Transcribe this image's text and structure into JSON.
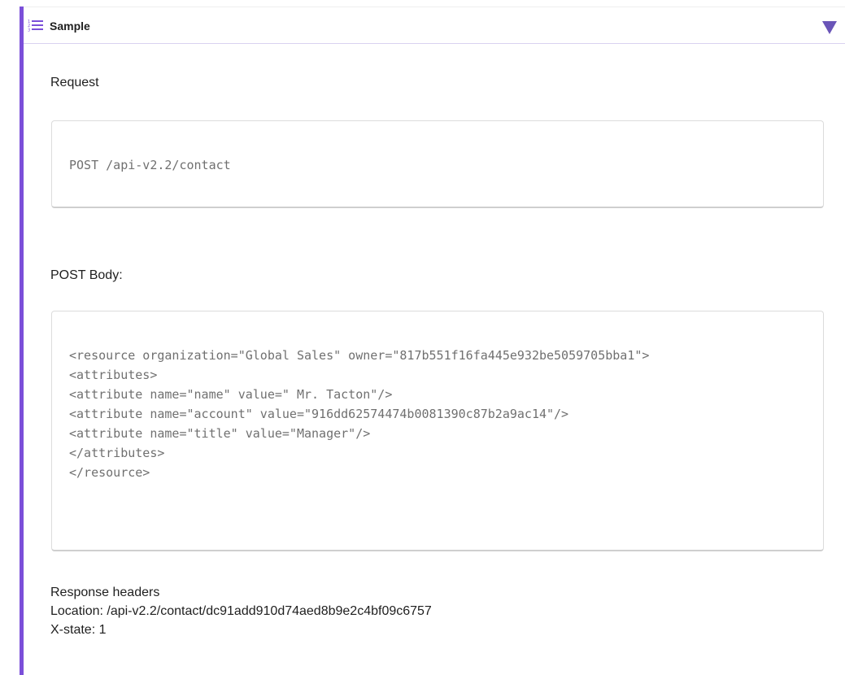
{
  "header": {
    "title": "Sample",
    "list_icon": "numbered-list-icon",
    "toggle_icon": "triangle-down-icon",
    "accent": "#7b4fd9"
  },
  "request": {
    "label": "Request",
    "code": "POST /api-v2.2/contact"
  },
  "post_body": {
    "label": "POST Body:",
    "lines": [
      "<resource organization=\"Global Sales\" owner=\"817b551f16fa445e932be5059705bba1\">",
      "<attributes>",
      "<attribute name=\"name\" value=\" Mr. Tacton\"/>",
      "<attribute name=\"account\" value=\"916dd62574474b0081390c87b2a9ac14\"/>",
      "<attribute name=\"title\" value=\"Manager\"/>",
      "</attributes>",
      "</resource>"
    ]
  },
  "response": {
    "label": "Response headers",
    "location": "Location: /api-v2.2/contact/dc91add910d74aed8b9e2c4bf09c6757",
    "state": "X-state: 1"
  }
}
